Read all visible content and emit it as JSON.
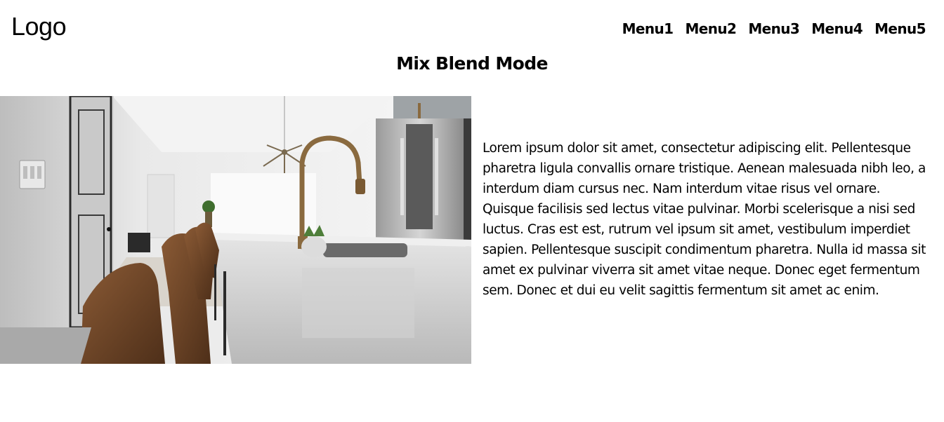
{
  "header": {
    "logo": "Logo",
    "menu": [
      "Menu1",
      "Menu2",
      "Menu3",
      "Menu4",
      "Menu5"
    ]
  },
  "main": {
    "title": "Mix Blend Mode",
    "paragraph": "Lorem ipsum dolor sit amet, consectetur adipiscing elit. Pellentesque pharetra ligula convallis ornare tristique. Aenean malesuada nibh leo, a interdum diam cursus nec. Nam interdum vitae risus vel ornare. Quisque facilisis sed lectus vitae pulvinar. Morbi scelerisque a nisi sed luctus. Cras est est, rutrum vel ipsum sit amet, vestibulum imperdiet sapien. Pellentesque suscipit condimentum pharetra. Nulla id massa sit amet ex pulvinar viverra sit amet vitae neque. Donec eget fermentum sem. Donec et dui eu velit sagittis fermentum sit amet ac enim."
  },
  "colors": {
    "text": "#000000",
    "background": "#ffffff",
    "stool_leather": "#6b4326",
    "faucet_brass": "#8a6a3f",
    "counter": "#cfcfcf"
  }
}
